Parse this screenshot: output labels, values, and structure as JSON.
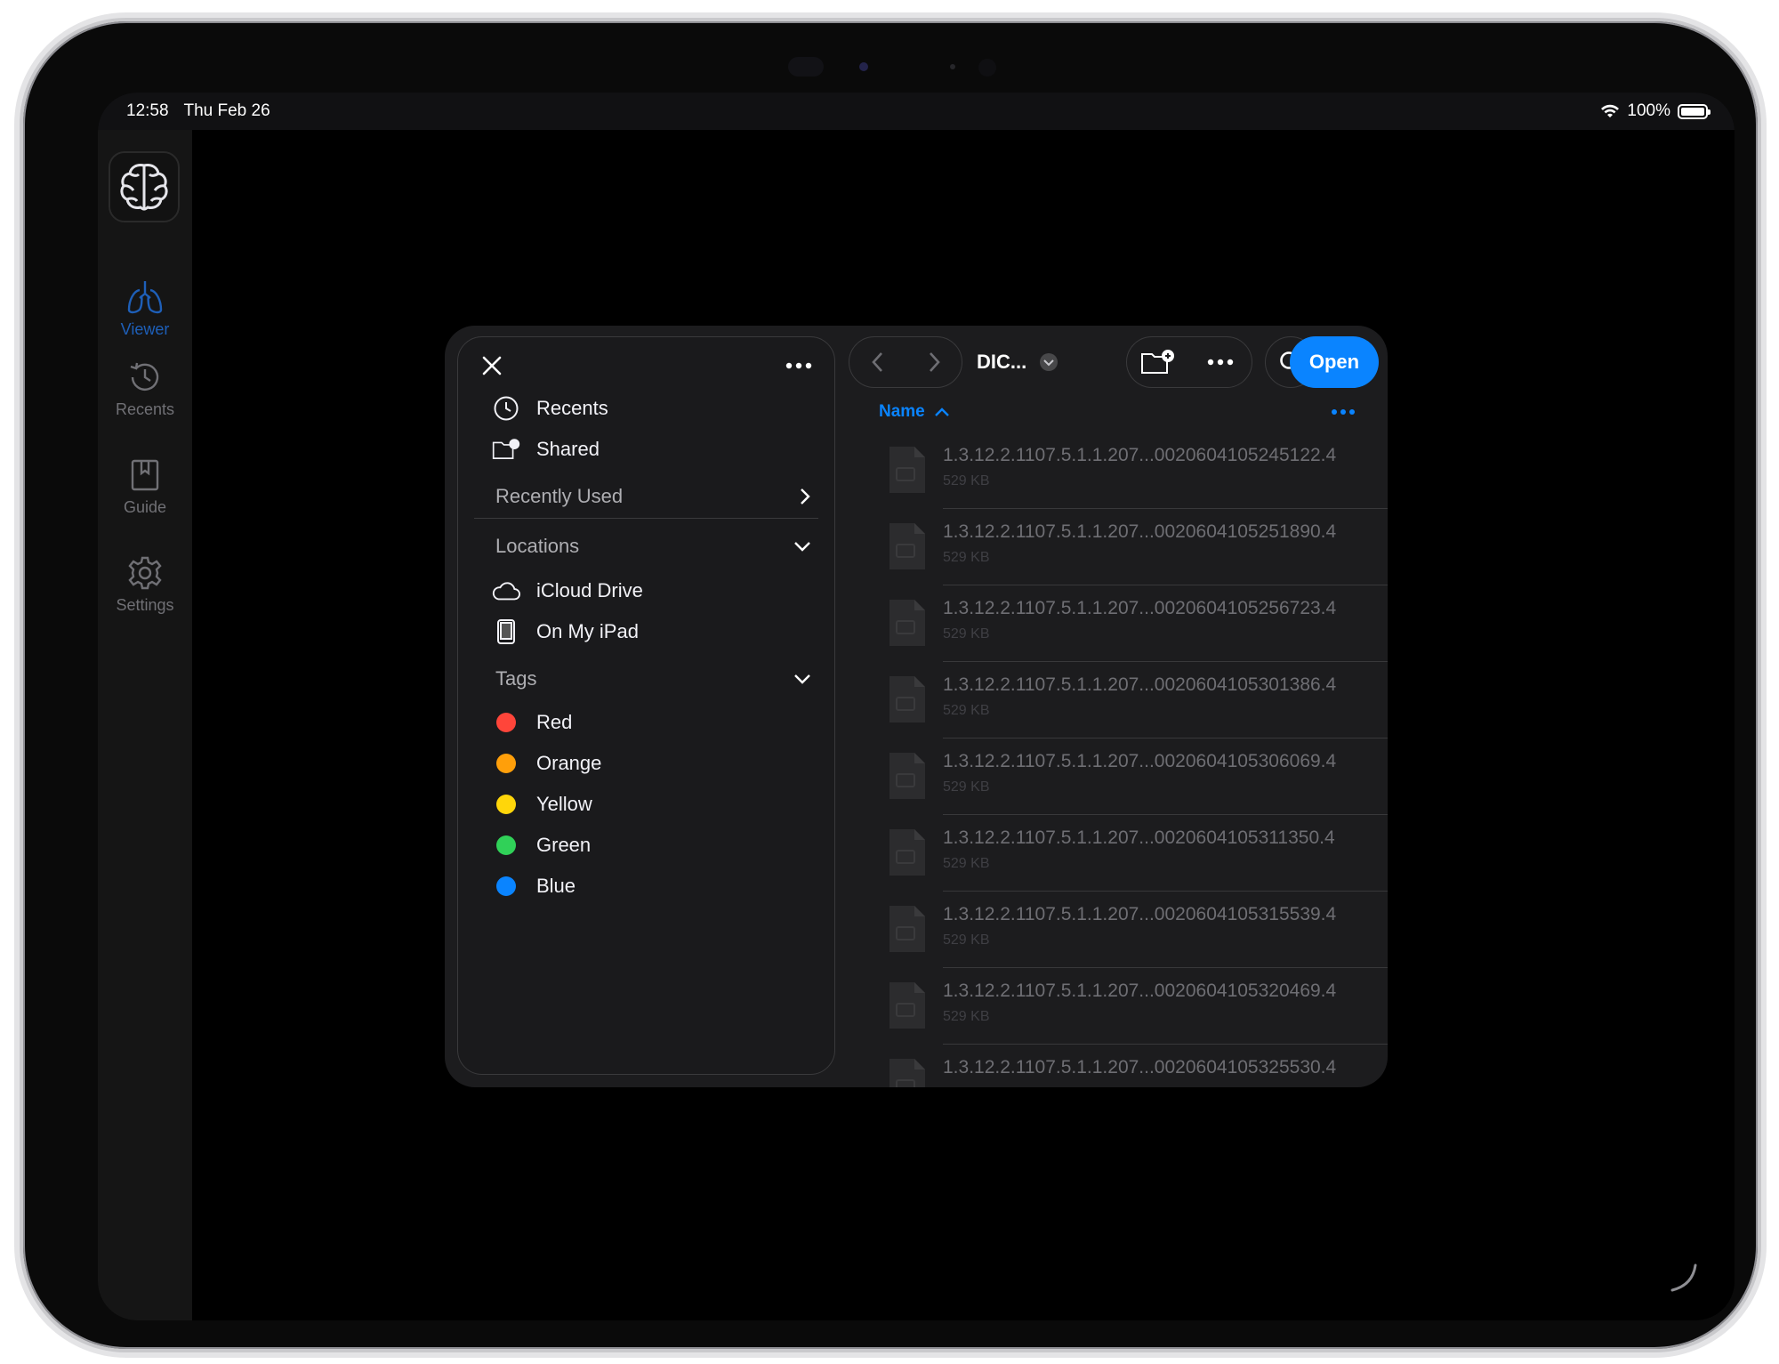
{
  "status_bar": {
    "time": "12:58",
    "date": "Thu Feb 26",
    "battery": "100%"
  },
  "app_nav": {
    "items": [
      {
        "label": "Viewer",
        "icon": "lungs-icon",
        "active": true
      },
      {
        "label": "Recents",
        "icon": "clock-history-icon"
      },
      {
        "label": "Guide",
        "icon": "book-icon"
      },
      {
        "label": "Settings",
        "icon": "gear-icon"
      }
    ]
  },
  "picker": {
    "sidebar": {
      "recents": "Recents",
      "shared": "Shared",
      "recently_used": "Recently Used",
      "locations_header": "Locations",
      "icloud": "iCloud Drive",
      "on_my_ipad": "On My iPad",
      "tags_header": "Tags",
      "tags": [
        {
          "label": "Red",
          "color": "#ff453a"
        },
        {
          "label": "Orange",
          "color": "#ff9f0a"
        },
        {
          "label": "Yellow",
          "color": "#ffd60a"
        },
        {
          "label": "Green",
          "color": "#30d158"
        },
        {
          "label": "Blue",
          "color": "#0a84ff"
        }
      ]
    },
    "toolbar": {
      "folder_name": "DIC...",
      "open_label": "Open"
    },
    "list": {
      "sort_label": "Name",
      "files": [
        {
          "name": "1.3.12.2.1107.5.1.1.207...0020604105245122.4",
          "size": "529 KB"
        },
        {
          "name": "1.3.12.2.1107.5.1.1.207...0020604105251890.4",
          "size": "529 KB"
        },
        {
          "name": "1.3.12.2.1107.5.1.1.207...0020604105256723.4",
          "size": "529 KB"
        },
        {
          "name": "1.3.12.2.1107.5.1.1.207...0020604105301386.4",
          "size": "529 KB"
        },
        {
          "name": "1.3.12.2.1107.5.1.1.207...0020604105306069.4",
          "size": "529 KB"
        },
        {
          "name": "1.3.12.2.1107.5.1.1.207...0020604105311350.4",
          "size": "529 KB"
        },
        {
          "name": "1.3.12.2.1107.5.1.1.207...0020604105315539.4",
          "size": "529 KB"
        },
        {
          "name": "1.3.12.2.1107.5.1.1.207...0020604105320469.4",
          "size": "529 KB"
        },
        {
          "name": "1.3.12.2.1107.5.1.1.207...0020604105325530.4",
          "size": ""
        }
      ]
    }
  }
}
